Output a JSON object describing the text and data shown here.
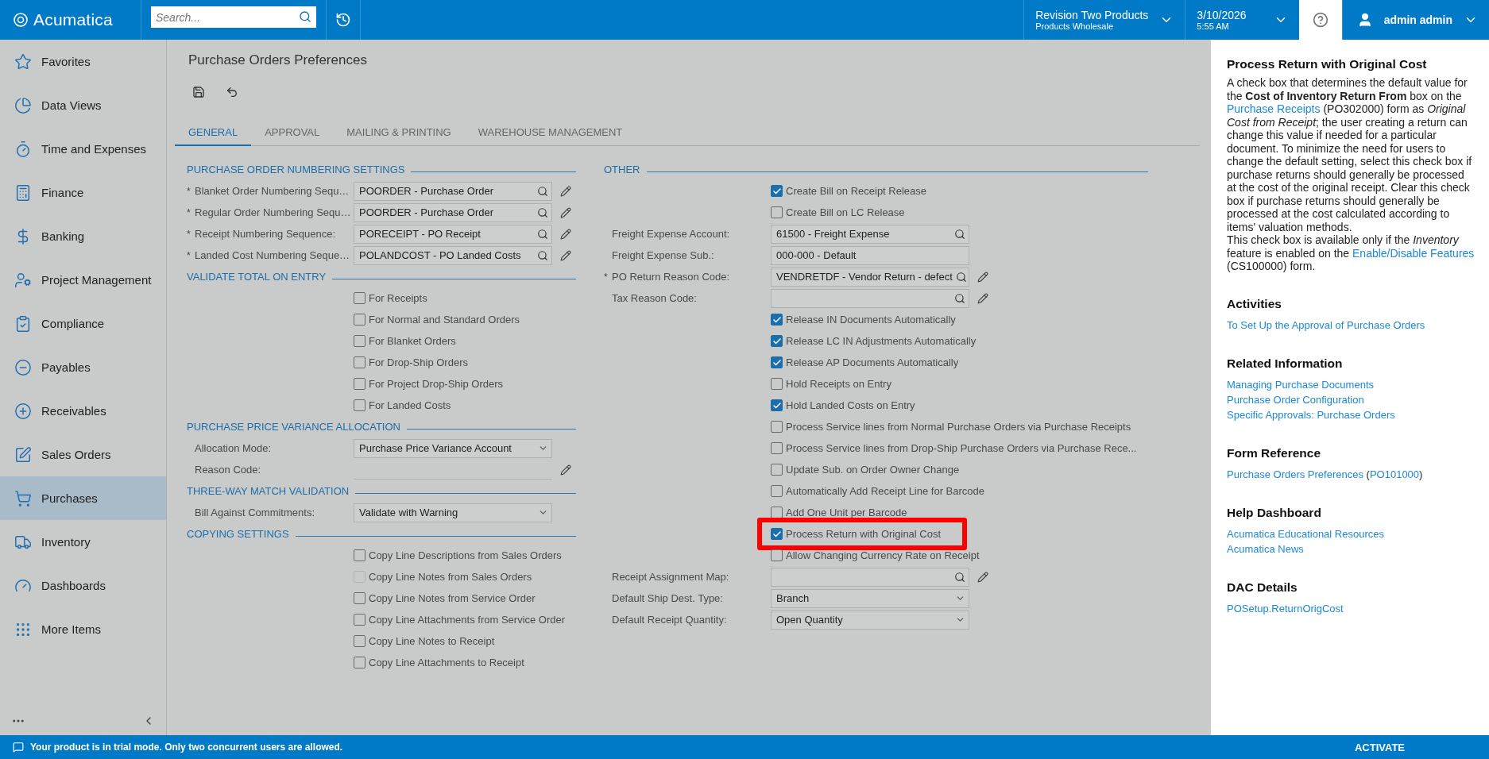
{
  "topbar": {
    "logo": "Acumatica",
    "search": {
      "placeholder": "Search..."
    },
    "company": {
      "name": "Revision Two Products",
      "branch": "Products Wholesale"
    },
    "date": {
      "date": "3/10/2026",
      "time": "5:55 AM"
    },
    "user": "admin admin"
  },
  "sidebar": {
    "items": [
      {
        "label": "Favorites",
        "selected": false
      },
      {
        "label": "Data Views",
        "selected": false
      },
      {
        "label": "Time and Expenses",
        "selected": false
      },
      {
        "label": "Finance",
        "selected": false
      },
      {
        "label": "Banking",
        "selected": false
      },
      {
        "label": "Project Management",
        "selected": false
      },
      {
        "label": "Compliance",
        "selected": false
      },
      {
        "label": "Payables",
        "selected": false
      },
      {
        "label": "Receivables",
        "selected": false
      },
      {
        "label": "Sales Orders",
        "selected": false
      },
      {
        "label": "Purchases",
        "selected": true
      },
      {
        "label": "Inventory",
        "selected": false
      },
      {
        "label": "Dashboards",
        "selected": false
      },
      {
        "label": "More Items",
        "selected": false
      }
    ]
  },
  "page": {
    "title": "Purchase Orders Preferences",
    "tabs": [
      {
        "label": "GENERAL",
        "selected": true
      },
      {
        "label": "APPROVAL",
        "selected": false
      },
      {
        "label": "MAILING & PRINTING",
        "selected": false
      },
      {
        "label": "WAREHOUSE MANAGEMENT",
        "selected": false
      }
    ],
    "columns": [
      {
        "sections": [
          {
            "title": "PURCHASE ORDER NUMBERING SETTINGS",
            "rows": [
              {
                "kind": "lookup",
                "label": "Blanket Order Numbering Sequ…",
                "marker": "*",
                "value": "POORDER - Purchase Order",
                "edit_button": true
              },
              {
                "kind": "lookup",
                "label": "Regular Order Numbering Sequ…",
                "marker": "*",
                "value": "POORDER - Purchase Order",
                "edit_button": true
              },
              {
                "kind": "lookup",
                "label": "Receipt Numbering Sequence:",
                "marker": "*",
                "value": "PORECEIPT - PO Receipt",
                "edit_button": true
              },
              {
                "kind": "lookup",
                "label": "Landed Cost Numbering Seque…",
                "marker": "*",
                "value": "POLANDCOST - PO Landed Costs",
                "edit_button": true
              }
            ]
          },
          {
            "title": "VALIDATE TOTAL ON ENTRY",
            "rows": [
              {
                "kind": "checkbox",
                "label": "For Receipts",
                "checked": false,
                "disabled": false,
                "highlighted": false
              },
              {
                "kind": "checkbox",
                "label": "For Normal and Standard Orders",
                "checked": false,
                "disabled": false,
                "highlighted": false
              },
              {
                "kind": "checkbox",
                "label": "For Blanket Orders",
                "checked": false,
                "disabled": false,
                "highlighted": false
              },
              {
                "kind": "checkbox",
                "label": "For Drop-Ship Orders",
                "checked": false,
                "disabled": false,
                "highlighted": false
              },
              {
                "kind": "checkbox",
                "label": "For Project Drop-Ship Orders",
                "checked": false,
                "disabled": false,
                "highlighted": false
              },
              {
                "kind": "checkbox",
                "label": "For Landed Costs",
                "checked": false,
                "disabled": false,
                "highlighted": false
              }
            ]
          },
          {
            "title": "PURCHASE PRICE VARIANCE ALLOCATION",
            "rows": [
              {
                "kind": "select",
                "label": "Allocation Mode:",
                "value": "Purchase Price Variance Account",
                "edit_button": false
              },
              {
                "kind": "line",
                "label": "Reason Code:",
                "edit_button": true
              }
            ]
          },
          {
            "title": "THREE-WAY MATCH VALIDATION",
            "rows": [
              {
                "kind": "select",
                "label": "Bill Against Commitments:",
                "value": "Validate with Warning",
                "edit_button": false
              }
            ]
          },
          {
            "title": "COPYING SETTINGS",
            "rows": [
              {
                "kind": "checkbox",
                "label": "Copy Line Descriptions from Sales Orders",
                "checked": false,
                "disabled": false,
                "highlighted": false
              },
              {
                "kind": "checkbox",
                "label": "Copy Line Notes from Sales Orders",
                "checked": false,
                "disabled": true,
                "highlighted": false
              },
              {
                "kind": "checkbox",
                "label": "Copy Line Notes from Service Order",
                "checked": false,
                "disabled": false,
                "highlighted": false
              },
              {
                "kind": "checkbox",
                "label": "Copy Line Attachments from Service Order",
                "checked": false,
                "disabled": false,
                "highlighted": false
              },
              {
                "kind": "checkbox",
                "label": "Copy Line Notes to Receipt",
                "checked": false,
                "disabled": false,
                "highlighted": false
              },
              {
                "kind": "checkbox",
                "label": "Copy Line Attachments to Receipt",
                "checked": false,
                "disabled": false,
                "highlighted": false
              }
            ]
          }
        ]
      },
      {
        "sections": [
          {
            "title": "OTHER",
            "rows": [
              {
                "kind": "checkbox",
                "label": "Create Bill on Receipt Release",
                "checked": true,
                "disabled": false,
                "highlighted": false
              },
              {
                "kind": "checkbox",
                "label": "Create Bill on LC Release",
                "checked": false,
                "disabled": false,
                "highlighted": false
              },
              {
                "kind": "lookup",
                "label": "Freight Expense Account:",
                "value": "61500 - Freight Expense",
                "edit_button": false
              },
              {
                "kind": "text",
                "label": "Freight Expense Sub.:",
                "value": "000-000 - Default",
                "edit_button": false
              },
              {
                "kind": "lookup",
                "label": "PO Return Reason Code:",
                "marker": "*",
                "value": "VENDRETDF - Vendor Return - defect",
                "edit_button": true
              },
              {
                "kind": "lookup",
                "label": "Tax Reason Code:",
                "edit_button": true
              },
              {
                "kind": "checkbox",
                "label": "Release IN Documents Automatically",
                "checked": true,
                "disabled": false,
                "highlighted": false
              },
              {
                "kind": "checkbox",
                "label": "Release LC IN Adjustments Automatically",
                "checked": true,
                "disabled": false,
                "highlighted": false
              },
              {
                "kind": "checkbox",
                "label": "Release AP Documents Automatically",
                "checked": true,
                "disabled": false,
                "highlighted": false
              },
              {
                "kind": "checkbox",
                "label": "Hold Receipts on Entry",
                "checked": false,
                "disabled": false,
                "highlighted": false
              },
              {
                "kind": "checkbox",
                "label": "Hold Landed Costs on Entry",
                "checked": true,
                "disabled": false,
                "highlighted": false
              },
              {
                "kind": "checkbox",
                "label": "Process Service lines from Normal Purchase Orders via Purchase Receipts",
                "checked": false,
                "disabled": false,
                "highlighted": false
              },
              {
                "kind": "checkbox",
                "label": "Process Service lines from Drop-Ship Purchase Orders via Purchase Rece...",
                "checked": false,
                "disabled": false,
                "highlighted": false
              },
              {
                "kind": "checkbox",
                "label": "Update Sub. on Order Owner Change",
                "checked": false,
                "disabled": false,
                "highlighted": false
              },
              {
                "kind": "checkbox",
                "label": "Automatically Add Receipt Line for Barcode",
                "checked": false,
                "disabled": false,
                "highlighted": false
              },
              {
                "kind": "checkbox",
                "label": "Add One Unit per Barcode",
                "checked": false,
                "disabled": false,
                "highlighted": false
              },
              {
                "kind": "checkbox",
                "label": "Process Return with Original Cost",
                "checked": true,
                "disabled": false,
                "highlighted": true
              },
              {
                "kind": "checkbox",
                "label": "Allow Changing Currency Rate on Receipt",
                "checked": false,
                "disabled": false,
                "highlighted": false
              },
              {
                "kind": "lookup",
                "label": "Receipt Assignment Map:",
                "edit_button": true
              },
              {
                "kind": "select",
                "label": "Default Ship Dest. Type:",
                "value": "Branch",
                "edit_button": false
              },
              {
                "kind": "select",
                "label": "Default Receipt Quantity:",
                "value": "Open Quantity",
                "edit_button": false
              }
            ]
          }
        ]
      }
    ]
  },
  "help": {
    "title": "Process Return with Original Cost",
    "paragraphs": [
      [
        {
          "text": "A check box that determines the default value for the **Cost of Inventory Return From** box on the "
        },
        {
          "link": "Purchase Receipts"
        },
        {
          "text": " (PO302000) form as *Original Cost from Receipt*; the user creating a return can change this value if needed for a particular document. To minimize the need for users to change the default setting, select this check box if purchase returns should generally be processed at the cost of the original receipt. Clear this check box if purchase returns should generally be processed at the cost calculated according to items' valuation methods."
        }
      ],
      [
        {
          "text": "This check box is available only if the *Inventory* feature is enabled on the "
        },
        {
          "link": "Enable/Disable Features"
        },
        {
          "text": " (CS100000) form."
        }
      ]
    ],
    "sections": [
      {
        "title": "Activities",
        "lines": [
          [
            {
              "link": "To Set Up the Approval of Purchase Orders"
            }
          ]
        ]
      },
      {
        "title": "Related Information",
        "lines": [
          [
            {
              "link": "Managing Purchase Documents"
            }
          ],
          [
            {
              "link": "Purchase Order Configuration"
            }
          ],
          [
            {
              "link": "Specific Approvals: Purchase Orders"
            }
          ]
        ]
      },
      {
        "title": "Form Reference",
        "lines": [
          [
            {
              "link": "Purchase Orders Preferences"
            },
            {
              "text": " ("
            },
            {
              "link": "PO101000"
            },
            {
              "text": ")"
            }
          ]
        ]
      },
      {
        "title": "Help Dashboard",
        "lines": [
          [
            {
              "link": "Acumatica Educational Resources"
            }
          ],
          [
            {
              "link": "Acumatica News"
            }
          ]
        ]
      },
      {
        "title": "DAC Details",
        "lines": [
          [
            {
              "link": "POSetup.ReturnOrigCost"
            }
          ]
        ]
      }
    ]
  },
  "status_bar": {
    "message": "Your product is in trial mode. Only two concurrent users are allowed.",
    "action": "ACTIVATE"
  }
}
